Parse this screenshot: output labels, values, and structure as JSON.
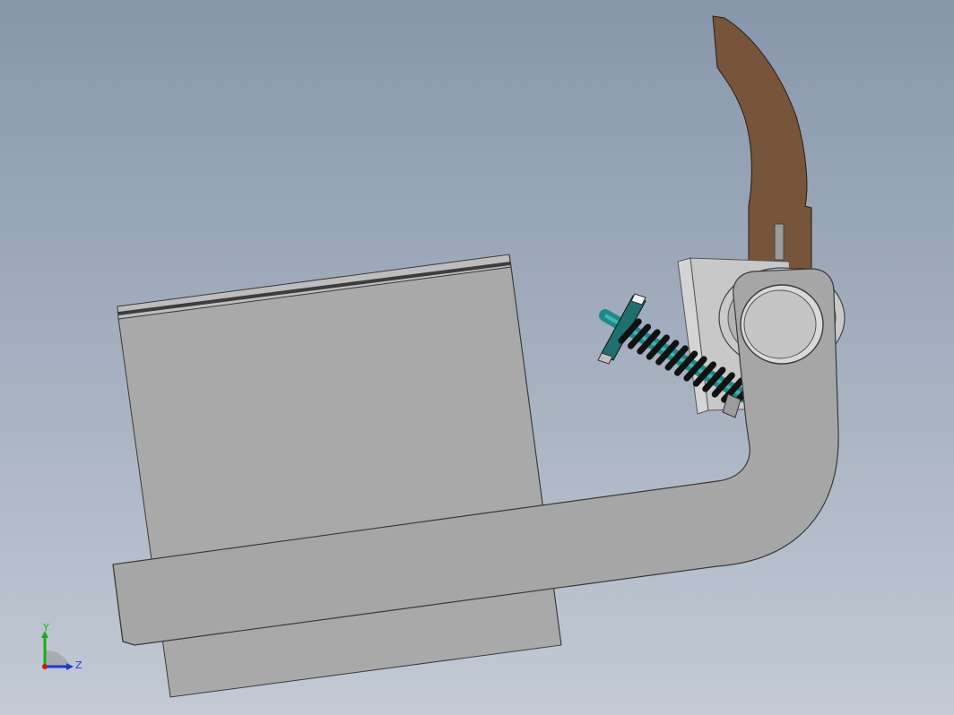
{
  "viewport": {
    "background_top": "#8797ab",
    "background_bottom": "#c3cad5"
  },
  "model": {
    "parts": [
      {
        "name": "housing-block",
        "color": "#a9a9a9"
      },
      {
        "name": "pedal-arm",
        "color": "#a6a6a6"
      },
      {
        "name": "foot-pedal",
        "color": "#76553a"
      },
      {
        "name": "spring-assembly",
        "spring_color": "#111111",
        "rod_color": "#1e8a8a"
      },
      {
        "name": "pivot-bushing",
        "color": "#c8c8c8"
      },
      {
        "name": "bracket-plate",
        "color": "#cfcfcf"
      }
    ]
  },
  "triad": {
    "y_label": "Y",
    "z_label": "Z",
    "y_color": "#16b016",
    "z_color": "#1a3ad6",
    "x_color": "#d01818"
  }
}
